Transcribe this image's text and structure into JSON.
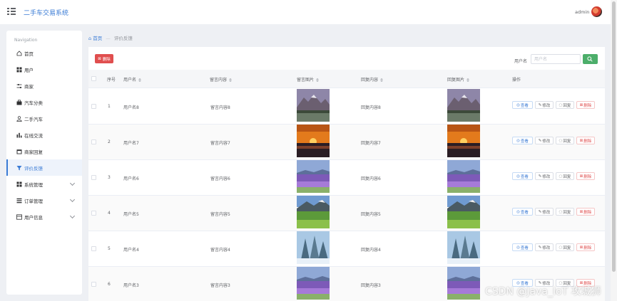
{
  "header": {
    "app_title": "二手车交易系统",
    "user_name": "admin"
  },
  "sidebar": {
    "heading": "Navigation",
    "items": [
      {
        "label": "首页",
        "icon": "home-icon"
      },
      {
        "label": "用户",
        "icon": "grid-icon"
      },
      {
        "label": "商家",
        "icon": "sliders-icon"
      },
      {
        "label": "汽车分类",
        "icon": "briefcase-icon"
      },
      {
        "label": "二手汽车",
        "icon": "user-icon"
      },
      {
        "label": "在线交流",
        "icon": "bar-chart-icon"
      },
      {
        "label": "商家回复",
        "icon": "calendar-icon"
      },
      {
        "label": "评价反馈",
        "icon": "filter-icon",
        "active": true
      },
      {
        "label": "系统管理",
        "icon": "grid-icon",
        "expandable": true
      },
      {
        "label": "订单管理",
        "icon": "list-icon",
        "expandable": true
      },
      {
        "label": "用户信息",
        "icon": "profile-icon",
        "expandable": true
      }
    ]
  },
  "breadcrumb": {
    "home": "首页",
    "separator": "—",
    "current": "评价反馈"
  },
  "toolbar": {
    "delete_label": "删除",
    "search_label": "用户名",
    "search_placeholder": "用户名",
    "search_value": ""
  },
  "table": {
    "columns": {
      "index": "序号",
      "username": "用户名",
      "message": "留言内容",
      "message_image": "留言图片",
      "reply": "回复内容",
      "reply_image": "回复图片",
      "actions": "操作"
    },
    "action_labels": {
      "view": "查看",
      "edit": "修改",
      "reply": "回复",
      "delete": "删除"
    },
    "rows": [
      {
        "index": "1",
        "username": "用户名8",
        "message": "留言内容8",
        "reply": "回复内容8",
        "image": "mountain-lake"
      },
      {
        "index": "2",
        "username": "用户名7",
        "message": "留言内容7",
        "reply": "回复内容7",
        "image": "sunset"
      },
      {
        "index": "3",
        "username": "用户名6",
        "message": "留言内容6",
        "reply": "回复内容6",
        "image": "lavender-field"
      },
      {
        "index": "4",
        "username": "用户名5",
        "message": "留言内容5",
        "reply": "回复内容5",
        "image": "green-valley"
      },
      {
        "index": "5",
        "username": "用户名4",
        "message": "留言内容4",
        "reply": "回复内容4",
        "image": "snowy-forest"
      },
      {
        "index": "6",
        "username": "用户名3",
        "message": "留言内容3",
        "reply": "回复内容3",
        "image": "lavender-field"
      }
    ]
  },
  "watermark": "CSDN @Java_IoT 攻城狮",
  "colors": {
    "accent": "#3a7bd5",
    "danger": "#e04e4e",
    "success": "#4cae6a"
  }
}
